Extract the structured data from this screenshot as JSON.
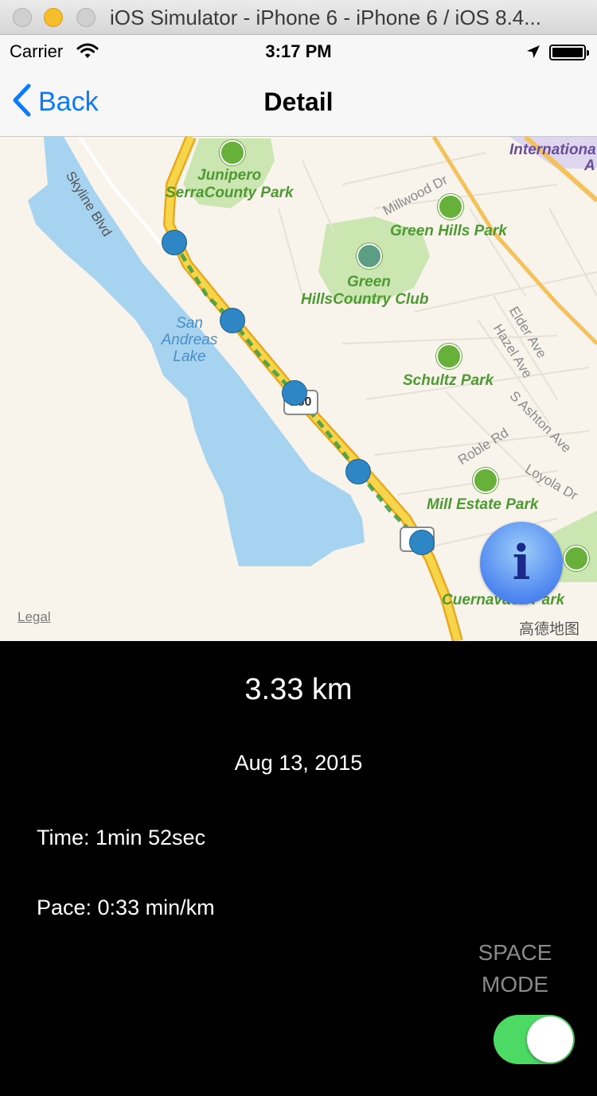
{
  "window": {
    "title": "iOS Simulator - iPhone 6 - iPhone 6 / iOS 8.4..."
  },
  "status_bar": {
    "carrier": "Carrier",
    "time": "3:17 PM"
  },
  "nav": {
    "back_label": "Back",
    "title": "Detail"
  },
  "map": {
    "labels": {
      "skyline": "Skyline Blvd",
      "international": "Internationa",
      "international_2": "A",
      "junipero": "Junipero",
      "serra": "SerraCounty Park",
      "millwood": "Millwood Dr",
      "green_hills_park": "Green Hills Park",
      "green": "Green",
      "hills_country_club": "HillsCountry Club",
      "san": "San",
      "andreas": "Andreas",
      "lake": "Lake",
      "elder": "Elder Ave",
      "hazel": "Hazel Ave",
      "schultz": "Schultz Park",
      "ashton": "S Ashton Ave",
      "roble": "Roble Rd",
      "loyola": "Loyola Dr",
      "mill_estate": "Mill Estate Park",
      "cuernavaca": "Cuernavaca Park",
      "shield_280_a": "280",
      "shield_280_b": "2"
    },
    "legal": "Legal",
    "provider": "高德地图",
    "info_glyph": "i"
  },
  "run": {
    "distance": "3.33 km",
    "date": "Aug 13, 2015",
    "time": "Time: 1min 52sec",
    "pace": "Pace: 0:33 min/km"
  },
  "space_mode": {
    "label_line1": "SPACE",
    "label_line2": "MODE",
    "enabled": true
  },
  "colors": {
    "accent": "#0a7aff",
    "toggle_on": "#4cd964",
    "waypoint": "#2f86c4"
  }
}
